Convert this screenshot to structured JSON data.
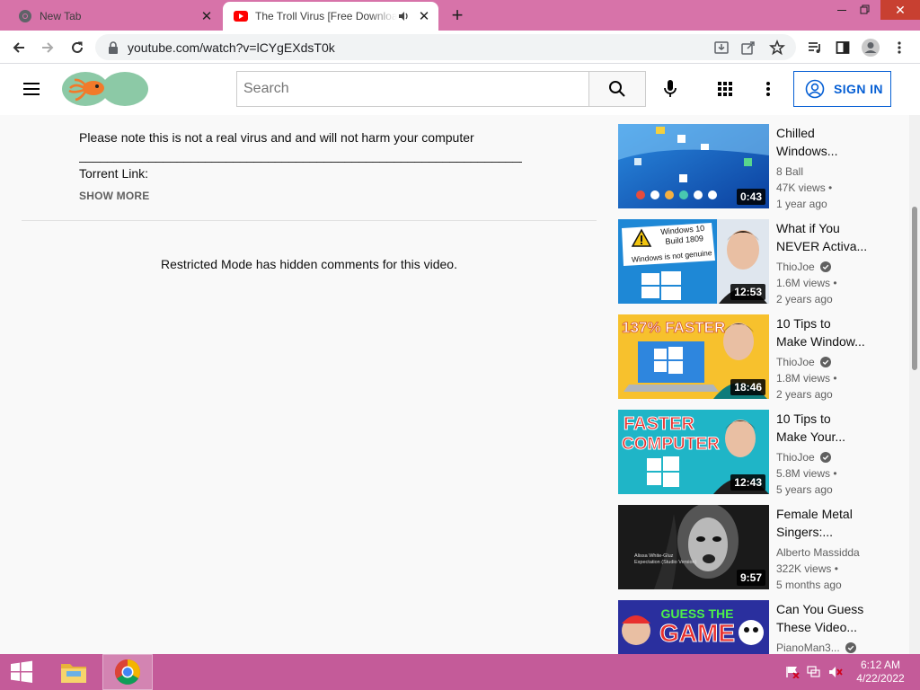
{
  "browser": {
    "tabs": [
      {
        "title": "New Tab",
        "favicon": "chrome-icon",
        "active": false
      },
      {
        "title": "The Troll Virus [Free Download]",
        "favicon": "youtube-icon",
        "active": true,
        "audio": true
      }
    ],
    "url": "youtube.com/watch?v=lCYgEXdsT0k"
  },
  "youtube": {
    "search_placeholder": "Search",
    "sign_in_label": "SIGN IN"
  },
  "description": {
    "line1": "Please note this is not a real virus and and will not harm your computer",
    "line2": "____________________________________________________________________________",
    "line3": "Torrent Link:",
    "show_more": "SHOW MORE"
  },
  "comments": {
    "restricted_text": "Restricted Mode has hidden comments for this video."
  },
  "related": [
    {
      "title1": "Chilled",
      "title2": "Windows...",
      "channel": "8 Ball",
      "verified": false,
      "views": "47K views",
      "age": "1 year ago",
      "duration": "0:43"
    },
    {
      "title1": "What if You",
      "title2": "NEVER Activa...",
      "channel": "ThioJoe",
      "verified": true,
      "views": "1.6M views",
      "age": "2 years ago",
      "duration": "12:53"
    },
    {
      "title1": "10 Tips to",
      "title2": "Make Window...",
      "channel": "ThioJoe",
      "verified": true,
      "views": "1.8M views",
      "age": "2 years ago",
      "duration": "18:46"
    },
    {
      "title1": "10 Tips to",
      "title2": "Make Your...",
      "channel": "ThioJoe",
      "verified": true,
      "views": "5.8M views",
      "age": "5 years ago",
      "duration": "12:43"
    },
    {
      "title1": "Female Metal",
      "title2": "Singers:...",
      "channel": "Alberto Massidda",
      "verified": false,
      "views": "322K views",
      "age": "5 months ago",
      "duration": "9:57"
    },
    {
      "title1": "Can You Guess",
      "title2": "These Video...",
      "channel": "PianoMan3...",
      "verified": true,
      "views": "",
      "age": "",
      "duration": ""
    }
  ],
  "thumb_text": {
    "t2_badge1": "Windows 10",
    "t2_badge2": "Build 1809",
    "t2_badge3": "Windows is not genuine",
    "t3_banner": "137% FASTER",
    "t4_line1": "FASTER",
    "t4_line2": "COMPUTER",
    "t5_caption1": "Alissa White-Gluz",
    "t5_caption2": "Expectation (Studio Version)",
    "t6_line1": "GUESS THE",
    "t6_line2": "GAME"
  },
  "taskbar": {
    "time": "6:12 AM",
    "date": "4/22/2022"
  },
  "colors": {
    "tabstrip": "#d773a9",
    "taskbar": "#c45b99",
    "link_blue": "#065fd4"
  }
}
